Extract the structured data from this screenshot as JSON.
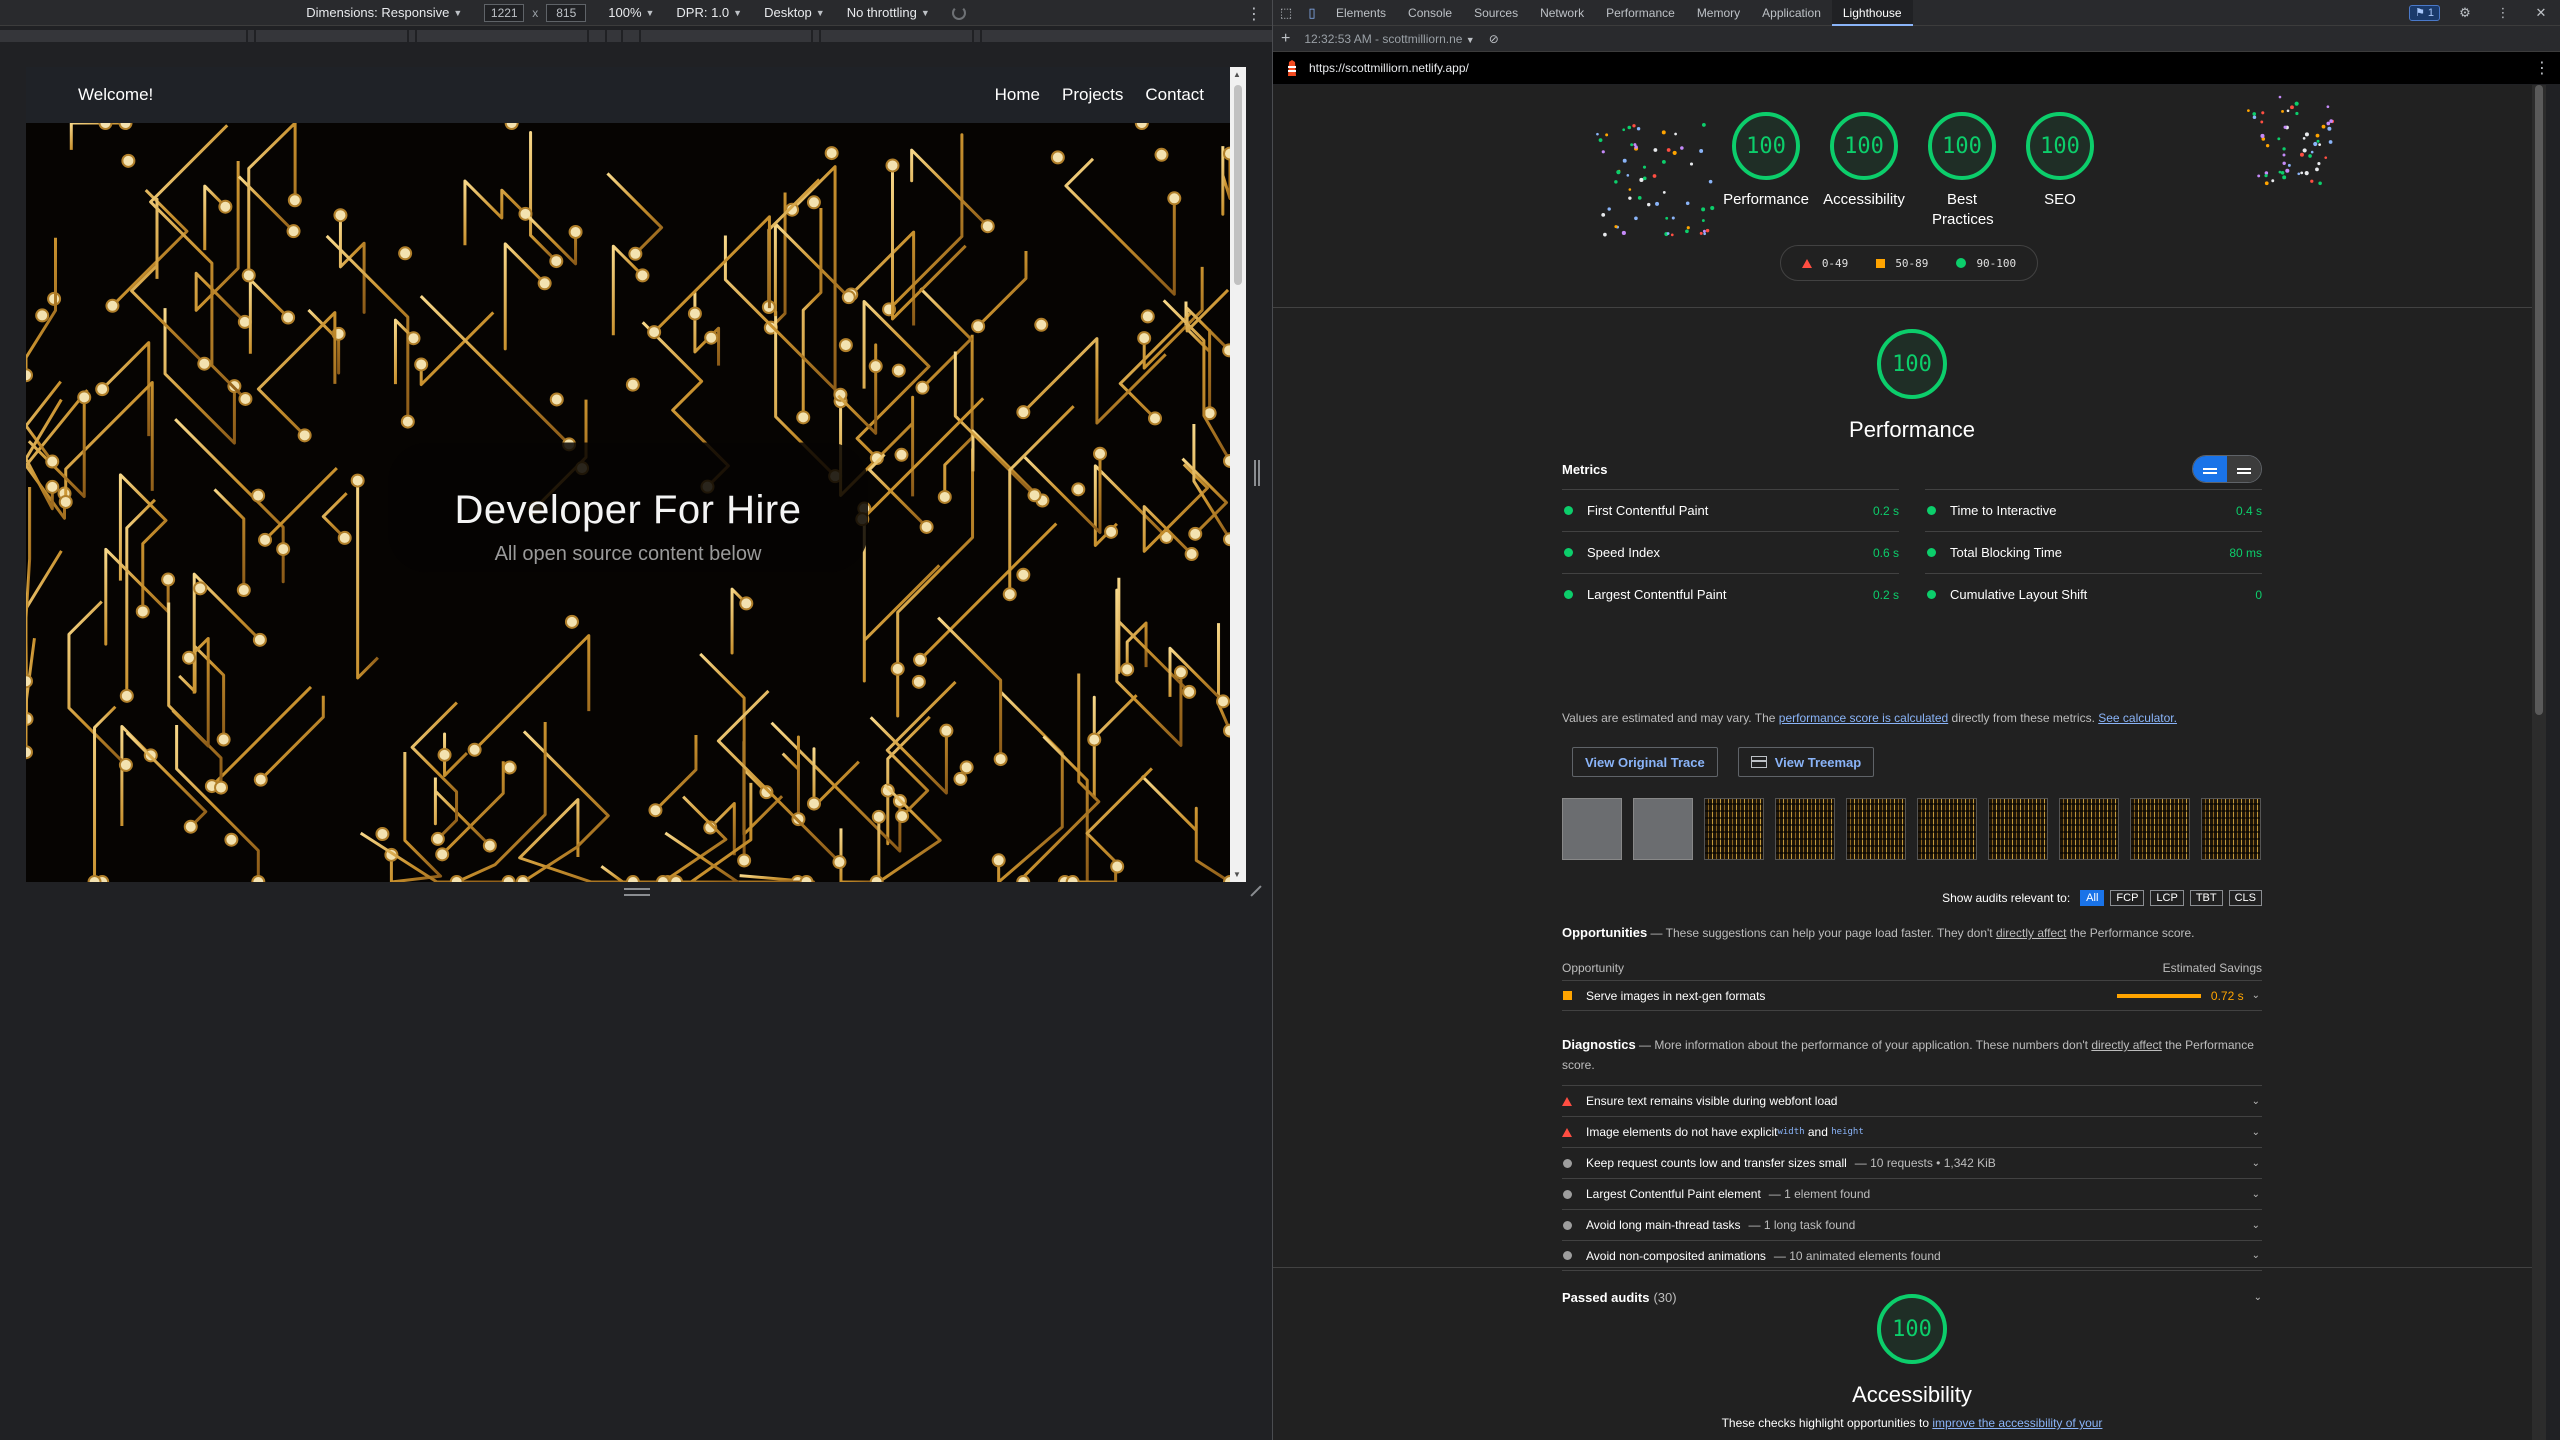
{
  "device_toolbar": {
    "dimensions_label": "Dimensions: Responsive",
    "width": "1221",
    "times": "x",
    "height": "815",
    "zoom": "100%",
    "dpr": "DPR: 1.0",
    "device_type": "Desktop",
    "throttling": "No throttling"
  },
  "site": {
    "brand": "Welcome!",
    "nav": [
      "Home",
      "Projects",
      "Contact"
    ],
    "hero_title": "Developer For Hire",
    "hero_subtitle": "All open source content below"
  },
  "devtools": {
    "tabs": [
      "Elements",
      "Console",
      "Sources",
      "Network",
      "Performance",
      "Memory",
      "Application",
      "Lighthouse"
    ],
    "active_tab": "Lighthouse",
    "issues_count": "1",
    "report_time": "12:32:53 AM - scottmilliorn.ne",
    "url": "https://scottmilliorn.netlify.app/"
  },
  "scores": [
    {
      "label": "Performance",
      "value": "100"
    },
    {
      "label": "Accessibility",
      "value": "100"
    },
    {
      "label": "Best Practices",
      "value": "100"
    },
    {
      "label": "SEO",
      "value": "100"
    }
  ],
  "legend": {
    "fail": "0-49",
    "average": "50-89",
    "pass": "90-100"
  },
  "colors": {
    "pass": "#0cce6b",
    "average": "#ffa400",
    "fail": "#ff4e42",
    "link": "#8ab4f8"
  },
  "performance": {
    "score": "100",
    "title": "Performance",
    "metrics_title": "Metrics",
    "metrics": [
      {
        "label": "First Contentful Paint",
        "value": "0.2 s"
      },
      {
        "label": "Time to Interactive",
        "value": "0.4 s"
      },
      {
        "label": "Speed Index",
        "value": "0.6 s"
      },
      {
        "label": "Total Blocking Time",
        "value": "80 ms"
      },
      {
        "label": "Largest Contentful Paint",
        "value": "0.2 s"
      },
      {
        "label": "Cumulative Layout Shift",
        "value": "0"
      }
    ],
    "note_prefix": "Values are estimated and may vary. The ",
    "note_link1": "performance score is calculated",
    "note_mid": " directly from these metrics. ",
    "note_link2": "See calculator.",
    "btn_trace": "View Original Trace",
    "btn_treemap": "View Treemap",
    "filter_label": "Show audits relevant to:",
    "filters": [
      "All",
      "FCP",
      "LCP",
      "TBT",
      "CLS"
    ]
  },
  "opportunities": {
    "title": "Opportunities",
    "desc": " — These suggestions can help your page load faster. They don't ",
    "desc_link": "directly affect",
    "desc_end": " the Performance score.",
    "col_left": "Opportunity",
    "col_right": "Estimated Savings",
    "items": [
      {
        "label": "Serve images in next-gen formats",
        "savings": "0.72 s"
      }
    ]
  },
  "diagnostics": {
    "title": "Diagnostics",
    "desc": " — More information about the performance of your application. These numbers don't ",
    "desc_link": "directly affect",
    "desc_end": " the Performance score.",
    "item1": "Ensure text remains visible during webfont load",
    "item2_a": "Image elements do not have explicit ",
    "item2_code1": "width",
    "item2_and": " and ",
    "item2_code2": "height",
    "item3": "Keep request counts low and transfer sizes small",
    "item3_sub": "— 10 requests • 1,342 KiB",
    "item4": "Largest Contentful Paint element",
    "item4_sub": "— 1 element found",
    "item5": "Avoid long main-thread tasks",
    "item5_sub": "— 1 long task found",
    "item6": "Avoid non-composited animations",
    "item6_sub": "— 10 animated elements found"
  },
  "passed": {
    "label": "Passed audits",
    "count": "(30)"
  },
  "accessibility": {
    "score": "100",
    "title": "Accessibility",
    "desc_prefix": "These checks highlight opportunities to ",
    "desc_link": "improve the accessibility of your"
  }
}
